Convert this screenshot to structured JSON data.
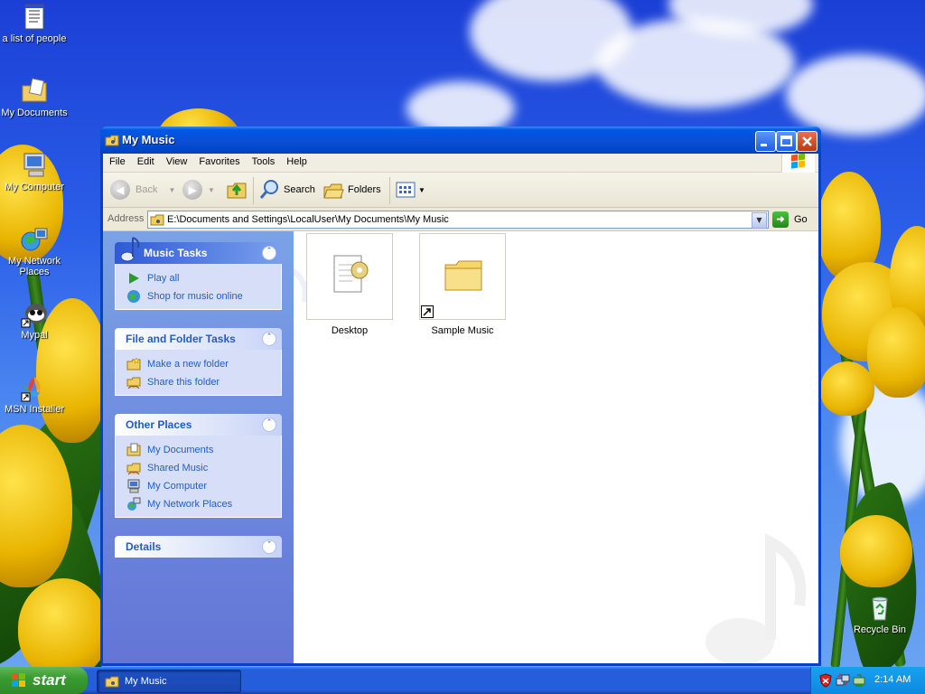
{
  "desktop": {
    "icons": [
      {
        "label": "a list of people",
        "icon": "document-icon"
      },
      {
        "label": "My Documents",
        "icon": "my-documents-icon"
      },
      {
        "label": "My Computer",
        "icon": "my-computer-icon"
      },
      {
        "label": "My Network Places",
        "icon": "network-places-icon"
      },
      {
        "label": "Mypal",
        "icon": "mypal-icon"
      },
      {
        "label": "MSN Installer",
        "icon": "msn-icon"
      },
      {
        "label": "Recycle Bin",
        "icon": "recycle-bin-icon"
      }
    ]
  },
  "window": {
    "title": "My Music",
    "menu": [
      "File",
      "Edit",
      "View",
      "Favorites",
      "Tools",
      "Help"
    ],
    "toolbar": {
      "back": "Back",
      "search": "Search",
      "folders": "Folders"
    },
    "address": {
      "label": "Address",
      "value": "E:\\Documents and Settings\\LocalUser\\My Documents\\My Music",
      "go": "Go"
    },
    "panels": {
      "music_tasks": {
        "title": "Music Tasks",
        "items": [
          "Play all",
          "Shop for music online"
        ]
      },
      "file_tasks": {
        "title": "File and Folder Tasks",
        "items": [
          "Make a new folder",
          "Share this folder"
        ]
      },
      "other_places": {
        "title": "Other Places",
        "items": [
          "My Documents",
          "Shared Music",
          "My Computer",
          "My Network Places"
        ]
      },
      "details": {
        "title": "Details"
      }
    },
    "files": [
      {
        "name": "Desktop",
        "icon": "desktop-ini-icon"
      },
      {
        "name": "Sample Music",
        "icon": "folder-shortcut-icon"
      }
    ]
  },
  "taskbar": {
    "start": "start",
    "task": "My Music",
    "clock": "2:14 AM"
  },
  "colors": {
    "titlebar": "#0a4fd6",
    "taskpane": "#7ba2e7",
    "start": "#3a9c32"
  }
}
